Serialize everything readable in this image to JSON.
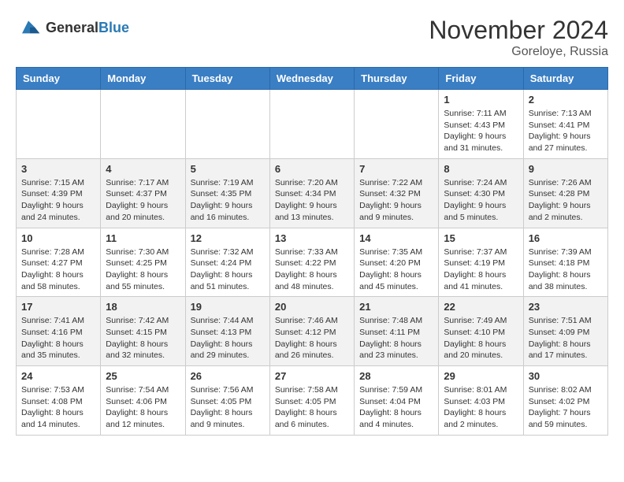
{
  "header": {
    "logo_line1": "General",
    "logo_line2": "Blue",
    "month": "November 2024",
    "location": "Goreloye, Russia"
  },
  "days_of_week": [
    "Sunday",
    "Monday",
    "Tuesday",
    "Wednesday",
    "Thursday",
    "Friday",
    "Saturday"
  ],
  "weeks": [
    [
      {
        "day": "",
        "info": ""
      },
      {
        "day": "",
        "info": ""
      },
      {
        "day": "",
        "info": ""
      },
      {
        "day": "",
        "info": ""
      },
      {
        "day": "",
        "info": ""
      },
      {
        "day": "1",
        "info": "Sunrise: 7:11 AM\nSunset: 4:43 PM\nDaylight: 9 hours and 31 minutes."
      },
      {
        "day": "2",
        "info": "Sunrise: 7:13 AM\nSunset: 4:41 PM\nDaylight: 9 hours and 27 minutes."
      }
    ],
    [
      {
        "day": "3",
        "info": "Sunrise: 7:15 AM\nSunset: 4:39 PM\nDaylight: 9 hours and 24 minutes."
      },
      {
        "day": "4",
        "info": "Sunrise: 7:17 AM\nSunset: 4:37 PM\nDaylight: 9 hours and 20 minutes."
      },
      {
        "day": "5",
        "info": "Sunrise: 7:19 AM\nSunset: 4:35 PM\nDaylight: 9 hours and 16 minutes."
      },
      {
        "day": "6",
        "info": "Sunrise: 7:20 AM\nSunset: 4:34 PM\nDaylight: 9 hours and 13 minutes."
      },
      {
        "day": "7",
        "info": "Sunrise: 7:22 AM\nSunset: 4:32 PM\nDaylight: 9 hours and 9 minutes."
      },
      {
        "day": "8",
        "info": "Sunrise: 7:24 AM\nSunset: 4:30 PM\nDaylight: 9 hours and 5 minutes."
      },
      {
        "day": "9",
        "info": "Sunrise: 7:26 AM\nSunset: 4:28 PM\nDaylight: 9 hours and 2 minutes."
      }
    ],
    [
      {
        "day": "10",
        "info": "Sunrise: 7:28 AM\nSunset: 4:27 PM\nDaylight: 8 hours and 58 minutes."
      },
      {
        "day": "11",
        "info": "Sunrise: 7:30 AM\nSunset: 4:25 PM\nDaylight: 8 hours and 55 minutes."
      },
      {
        "day": "12",
        "info": "Sunrise: 7:32 AM\nSunset: 4:24 PM\nDaylight: 8 hours and 51 minutes."
      },
      {
        "day": "13",
        "info": "Sunrise: 7:33 AM\nSunset: 4:22 PM\nDaylight: 8 hours and 48 minutes."
      },
      {
        "day": "14",
        "info": "Sunrise: 7:35 AM\nSunset: 4:20 PM\nDaylight: 8 hours and 45 minutes."
      },
      {
        "day": "15",
        "info": "Sunrise: 7:37 AM\nSunset: 4:19 PM\nDaylight: 8 hours and 41 minutes."
      },
      {
        "day": "16",
        "info": "Sunrise: 7:39 AM\nSunset: 4:18 PM\nDaylight: 8 hours and 38 minutes."
      }
    ],
    [
      {
        "day": "17",
        "info": "Sunrise: 7:41 AM\nSunset: 4:16 PM\nDaylight: 8 hours and 35 minutes."
      },
      {
        "day": "18",
        "info": "Sunrise: 7:42 AM\nSunset: 4:15 PM\nDaylight: 8 hours and 32 minutes."
      },
      {
        "day": "19",
        "info": "Sunrise: 7:44 AM\nSunset: 4:13 PM\nDaylight: 8 hours and 29 minutes."
      },
      {
        "day": "20",
        "info": "Sunrise: 7:46 AM\nSunset: 4:12 PM\nDaylight: 8 hours and 26 minutes."
      },
      {
        "day": "21",
        "info": "Sunrise: 7:48 AM\nSunset: 4:11 PM\nDaylight: 8 hours and 23 minutes."
      },
      {
        "day": "22",
        "info": "Sunrise: 7:49 AM\nSunset: 4:10 PM\nDaylight: 8 hours and 20 minutes."
      },
      {
        "day": "23",
        "info": "Sunrise: 7:51 AM\nSunset: 4:09 PM\nDaylight: 8 hours and 17 minutes."
      }
    ],
    [
      {
        "day": "24",
        "info": "Sunrise: 7:53 AM\nSunset: 4:08 PM\nDaylight: 8 hours and 14 minutes."
      },
      {
        "day": "25",
        "info": "Sunrise: 7:54 AM\nSunset: 4:06 PM\nDaylight: 8 hours and 12 minutes."
      },
      {
        "day": "26",
        "info": "Sunrise: 7:56 AM\nSunset: 4:05 PM\nDaylight: 8 hours and 9 minutes."
      },
      {
        "day": "27",
        "info": "Sunrise: 7:58 AM\nSunset: 4:05 PM\nDaylight: 8 hours and 6 minutes."
      },
      {
        "day": "28",
        "info": "Sunrise: 7:59 AM\nSunset: 4:04 PM\nDaylight: 8 hours and 4 minutes."
      },
      {
        "day": "29",
        "info": "Sunrise: 8:01 AM\nSunset: 4:03 PM\nDaylight: 8 hours and 2 minutes."
      },
      {
        "day": "30",
        "info": "Sunrise: 8:02 AM\nSunset: 4:02 PM\nDaylight: 7 hours and 59 minutes."
      }
    ]
  ]
}
